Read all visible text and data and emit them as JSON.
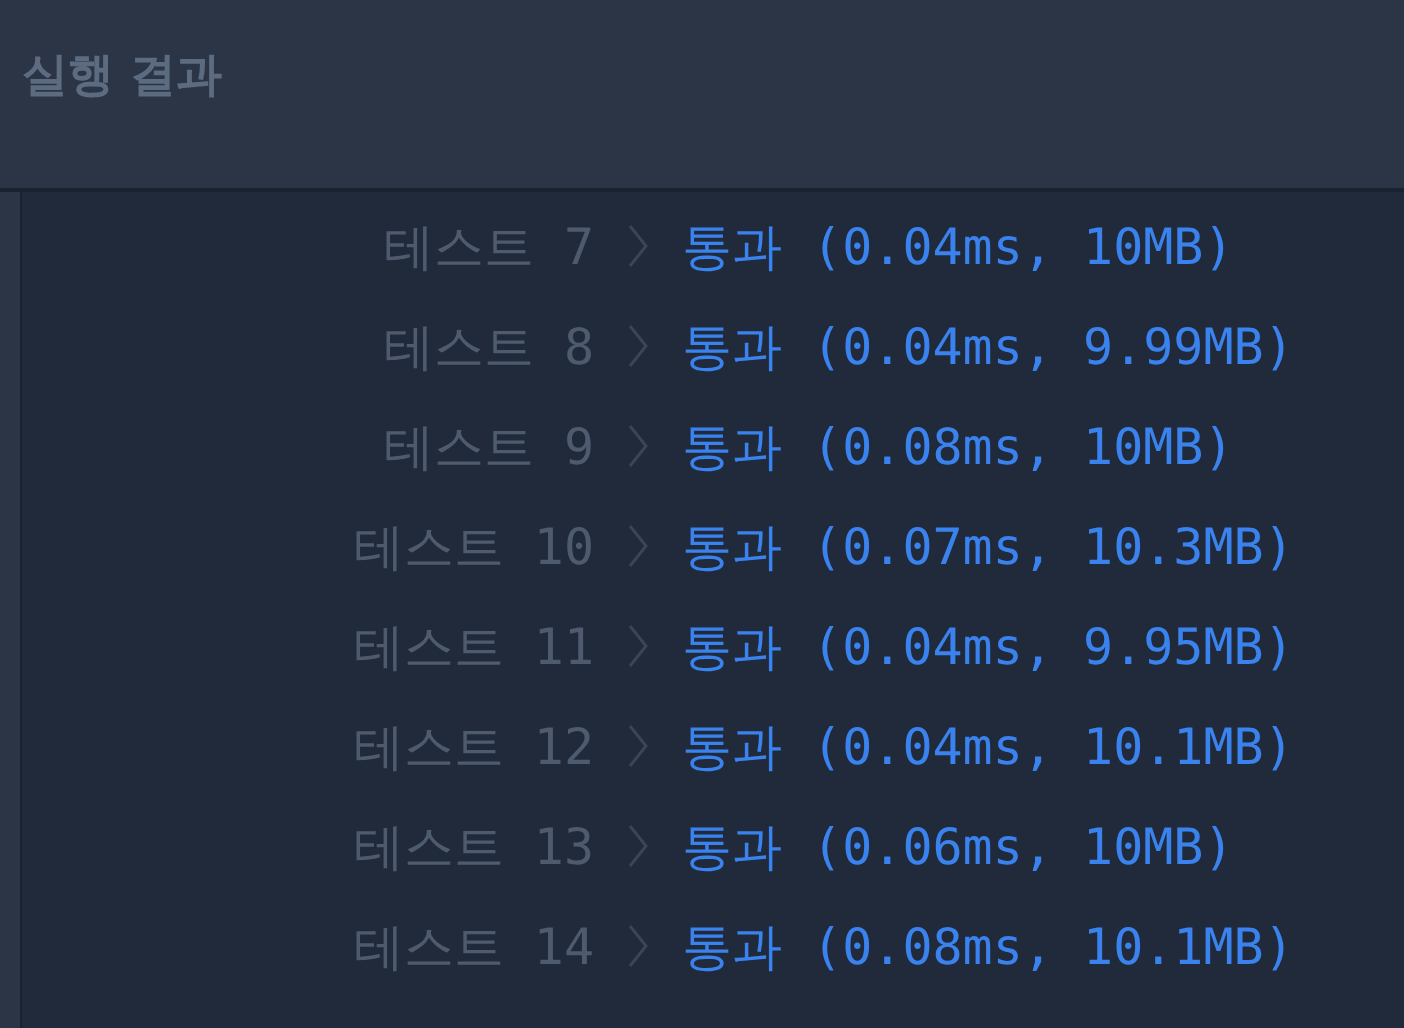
{
  "panel": {
    "title": "실행 결과"
  },
  "results": [
    {
      "test": "테스트 7",
      "result": "통과 (0.04ms, 10MB)"
    },
    {
      "test": "테스트 8",
      "result": "통과 (0.04ms, 9.99MB)"
    },
    {
      "test": "테스트 9",
      "result": "통과 (0.08ms, 10MB)"
    },
    {
      "test": "테스트 10",
      "result": "통과 (0.07ms, 10.3MB)"
    },
    {
      "test": "테스트 11",
      "result": "통과 (0.04ms, 9.95MB)"
    },
    {
      "test": "테스트 12",
      "result": "통과 (0.04ms, 10.1MB)"
    },
    {
      "test": "테스트 13",
      "result": "통과 (0.06ms, 10MB)"
    },
    {
      "test": "테스트 14",
      "result": "통과 (0.08ms, 10.1MB)"
    }
  ]
}
